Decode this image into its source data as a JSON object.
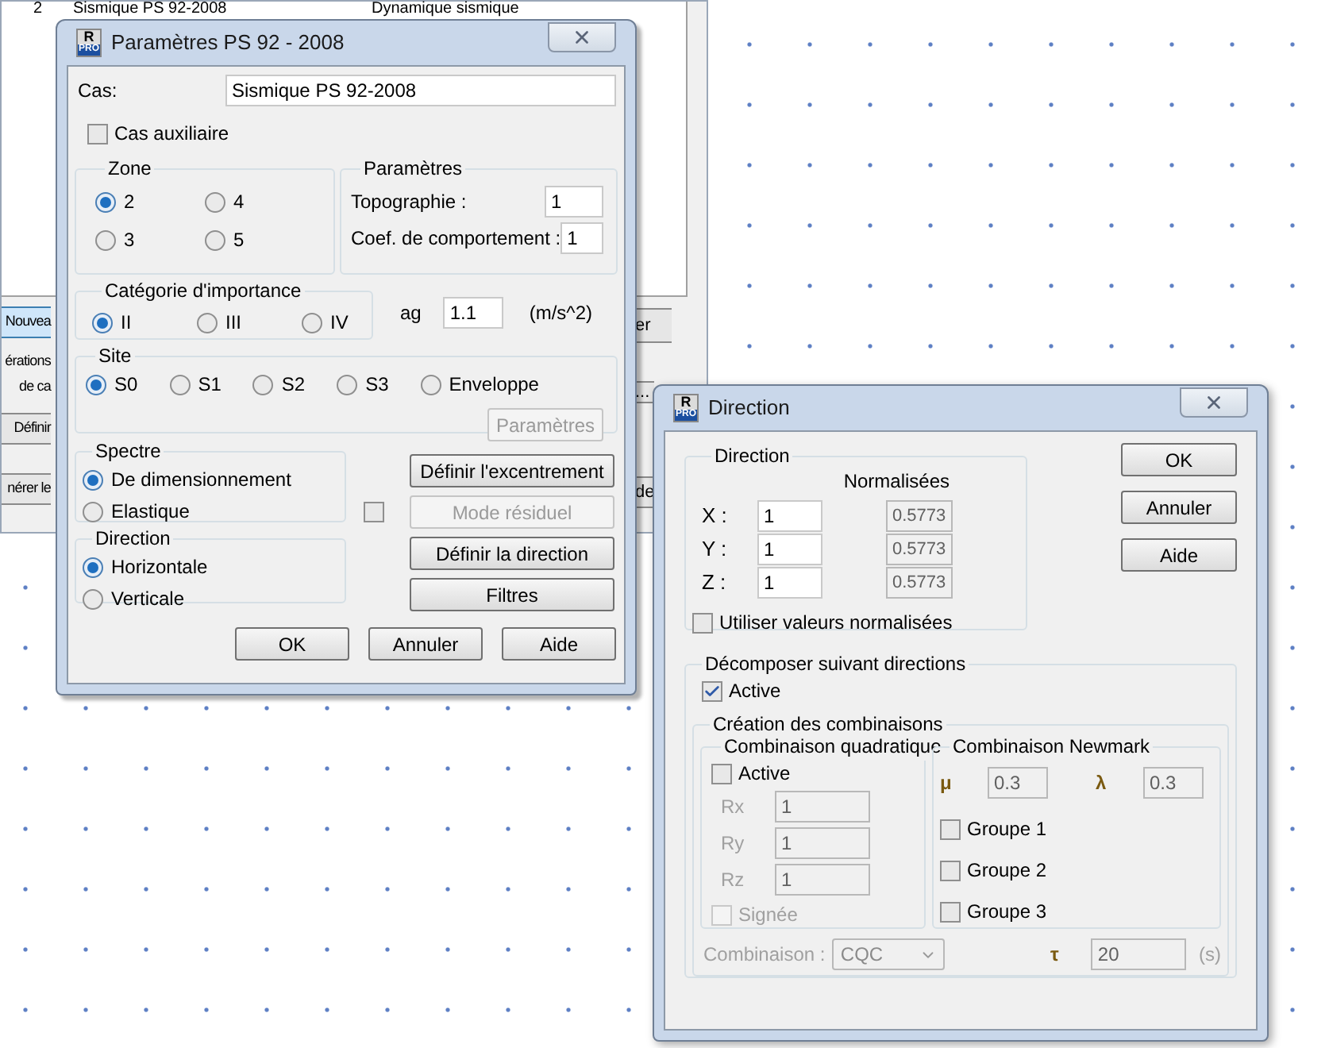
{
  "background_window": {
    "table_row": {
      "column_1": "2",
      "column_2": "Sismique PS 92-2008",
      "column_3": "Dynamique sismique"
    },
    "left_items": [
      {
        "kind": "button",
        "label": "Nouvea",
        "selected": true
      },
      {
        "kind": "label",
        "label": "érations"
      },
      {
        "kind": "label",
        "label": "de ca"
      },
      {
        "kind": "button",
        "label": "Définir",
        "selected": false
      },
      {
        "kind": "button",
        "label": "nérer le",
        "selected": false
      }
    ],
    "right_items": [
      {
        "kind": "button",
        "label": "er"
      },
      {
        "kind": "button",
        "label": "..."
      },
      {
        "kind": "button",
        "label": "de"
      }
    ]
  },
  "params_dialog": {
    "logo": {
      "top": "R",
      "bottom": "PRO"
    },
    "title": "Paramètres PS 92 - 2008",
    "cas": {
      "label": "Cas:",
      "value": "Sismique PS 92-2008"
    },
    "auxiliary": {
      "label": "Cas auxiliaire",
      "checked": false
    },
    "zone": {
      "title": "Zone",
      "options": [
        {
          "label": "2",
          "selected": true
        },
        {
          "label": "4",
          "selected": false
        },
        {
          "label": "3",
          "selected": false
        },
        {
          "label": "5",
          "selected": false
        }
      ]
    },
    "parametres": {
      "title": "Paramètres",
      "fields": [
        {
          "label": "Topographie :",
          "value": "1"
        },
        {
          "label": "Coef. de comportement :",
          "value": "1"
        }
      ]
    },
    "categorie": {
      "title": "Catégorie d'importance",
      "options": [
        {
          "label": "II",
          "selected": true
        },
        {
          "label": "III",
          "selected": false
        },
        {
          "label": "IV",
          "selected": false
        }
      ]
    },
    "ag": {
      "label": "ag",
      "value": "1.1",
      "unit": "(m/s^2)"
    },
    "site": {
      "title": "Site",
      "options": [
        {
          "label": "S0",
          "selected": true
        },
        {
          "label": "S1",
          "selected": false
        },
        {
          "label": "S2",
          "selected": false
        },
        {
          "label": "S3",
          "selected": false
        },
        {
          "label": "Enveloppe",
          "selected": false
        }
      ],
      "button": {
        "label": "Paramètres",
        "disabled": true
      }
    },
    "spectre": {
      "title": "Spectre",
      "options": [
        {
          "label": "De dimensionnement",
          "selected": true
        },
        {
          "label": "Elastique",
          "selected": false
        }
      ]
    },
    "direction": {
      "title": "Direction",
      "options": [
        {
          "label": "Horizontale",
          "selected": true
        },
        {
          "label": "Verticale",
          "selected": false
        }
      ]
    },
    "residual_checkbox": {
      "checked": false
    },
    "side_buttons": [
      {
        "label": "Définir l'excentrement",
        "disabled": false
      },
      {
        "label": "Mode résiduel",
        "disabled": true
      },
      {
        "label": "Définir la direction",
        "disabled": false
      },
      {
        "label": "Filtres",
        "disabled": false
      }
    ],
    "footer_buttons": [
      "OK",
      "Annuler",
      "Aide"
    ]
  },
  "direction_dialog": {
    "logo": {
      "top": "R",
      "bottom": "PRO"
    },
    "title": "Direction",
    "direction_group": {
      "title": "Direction",
      "normalized_heading": "Normalisées",
      "axes": [
        {
          "label": "X :",
          "value": "1",
          "normalized": "0.5773"
        },
        {
          "label": "Y :",
          "value": "1",
          "normalized": "0.5773"
        },
        {
          "label": "Z :",
          "value": "1",
          "normalized": "0.5773"
        }
      ],
      "use_normalized": {
        "label": "Utiliser valeurs normalisées",
        "checked": false
      }
    },
    "buttons": [
      "OK",
      "Annuler",
      "Aide"
    ],
    "decompose": {
      "title": "Décomposer suivant directions",
      "active": {
        "label": "Active",
        "checked": true
      },
      "creation": {
        "title": "Création des combinaisons",
        "quadratic": {
          "title": "Combinaison quadratique",
          "active": {
            "label": "Active",
            "checked": false
          },
          "disabled": true,
          "fields": [
            {
              "label": "Rx",
              "value": "1"
            },
            {
              "label": "Ry",
              "value": "1"
            },
            {
              "label": "Rz",
              "value": "1"
            }
          ],
          "signed": {
            "label": "Signée",
            "checked": false
          }
        },
        "newmark": {
          "title": "Combinaison Newmark",
          "mu": {
            "symbol": "μ",
            "value": "0.3"
          },
          "lambda": {
            "symbol": "λ",
            "value": "0.3"
          },
          "groups": [
            {
              "label": "Groupe 1",
              "checked": false
            },
            {
              "label": "Groupe 2",
              "checked": false
            },
            {
              "label": "Groupe 3",
              "checked": false
            }
          ]
        }
      },
      "combination": {
        "label": "Combinaison :",
        "value": "CQC",
        "disabled": true
      },
      "tau": {
        "symbol": "τ",
        "value": "20",
        "unit": "(s)",
        "disabled": true
      }
    }
  }
}
